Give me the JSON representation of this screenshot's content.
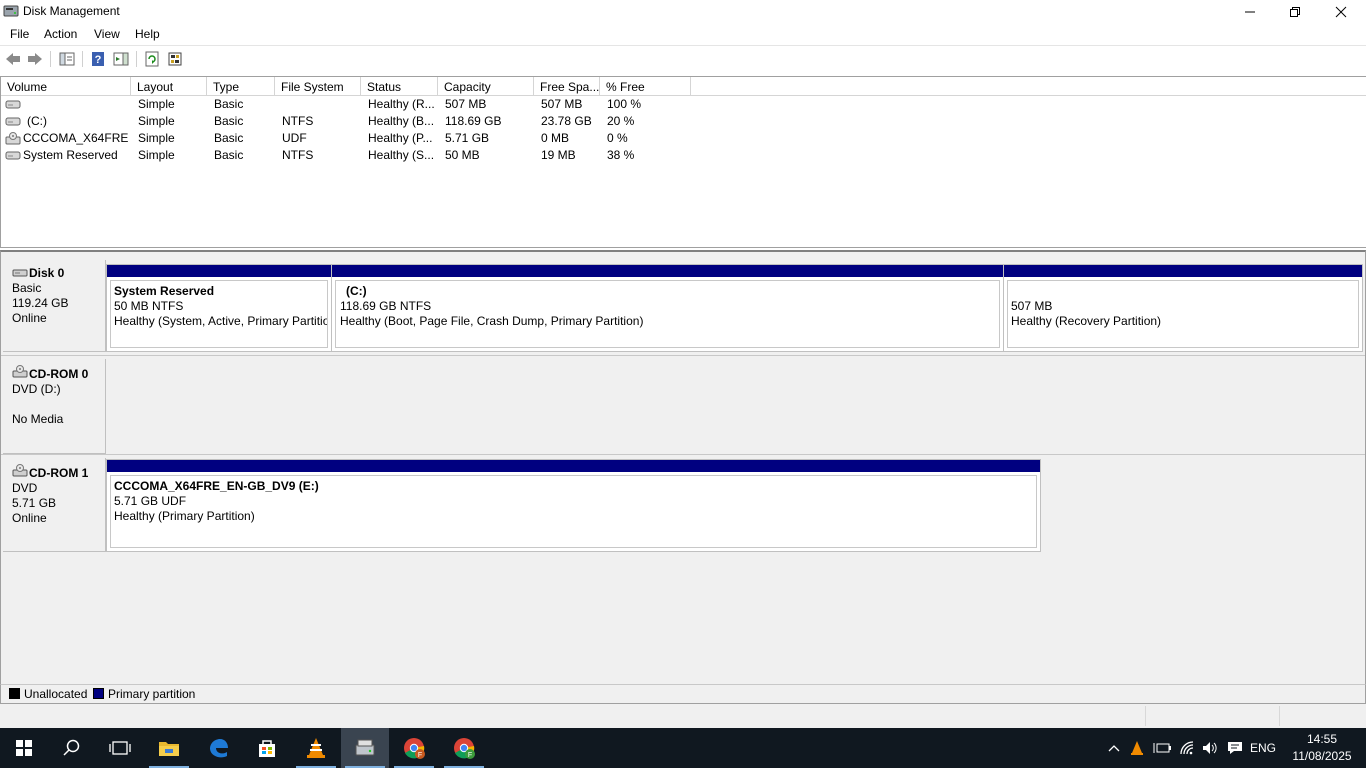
{
  "window": {
    "title": "Disk Management",
    "icon": "disk-management-icon"
  },
  "menu": [
    "File",
    "Action",
    "View",
    "Help"
  ],
  "toolbar": {
    "icons": [
      "back-arrow-icon",
      "forward-arrow-icon",
      "console-tree-icon",
      "help-icon",
      "action-pane-icon",
      "refresh-icon",
      "properties-icon"
    ]
  },
  "volume_table": {
    "columns": [
      "Volume",
      "Layout",
      "Type",
      "File System",
      "Status",
      "Capacity",
      "Free Spa...",
      "% Free"
    ],
    "rows": [
      {
        "volume": "",
        "layout": "Simple",
        "type": "Basic",
        "fs": "",
        "status": "Healthy (R...",
        "capacity": "507 MB",
        "free": "507 MB",
        "pct": "100 %",
        "icon": "drive-icon"
      },
      {
        "volume": "(C:)",
        "layout": "Simple",
        "type": "Basic",
        "fs": "NTFS",
        "status": "Healthy (B...",
        "capacity": "118.69 GB",
        "free": "23.78 GB",
        "pct": "20 %",
        "icon": "drive-icon"
      },
      {
        "volume": "CCCOMA_X64FRE...",
        "layout": "Simple",
        "type": "Basic",
        "fs": "UDF",
        "status": "Healthy (P...",
        "capacity": "5.71 GB",
        "free": "0 MB",
        "pct": "0 %",
        "icon": "cd-drive-icon"
      },
      {
        "volume": "System Reserved",
        "layout": "Simple",
        "type": "Basic",
        "fs": "NTFS",
        "status": "Healthy (S...",
        "capacity": "50 MB",
        "free": "19 MB",
        "pct": "38 %",
        "icon": "drive-icon"
      }
    ]
  },
  "disks": [
    {
      "name": "Disk 0",
      "line1": "Basic",
      "line2": "119.24 GB",
      "line3": "Online",
      "partitions": [
        {
          "name": "System Reserved",
          "size": "50 MB NTFS",
          "status": "Healthy (System, Active, Primary Partition)"
        },
        {
          "name": "(C:)",
          "size": "118.69 GB NTFS",
          "status": "Healthy (Boot, Page File, Crash Dump, Primary Partition)"
        },
        {
          "name": "",
          "size": "507 MB",
          "status": "Healthy (Recovery Partition)"
        }
      ]
    },
    {
      "name": "CD-ROM 0",
      "line1": "DVD (D:)",
      "line2": "",
      "line3": "No Media",
      "partitions": []
    },
    {
      "name": "CD-ROM 1",
      "line1": "DVD",
      "line2": "5.71 GB",
      "line3": "Online",
      "partitions": [
        {
          "name": "CCCOMA_X64FRE_EN-GB_DV9  (E:)",
          "size": "5.71 GB UDF",
          "status": "Healthy (Primary Partition)"
        }
      ]
    }
  ],
  "legend": [
    {
      "label": "Unallocated",
      "color": "#000000"
    },
    {
      "label": "Primary partition",
      "color": "#000080"
    }
  ],
  "taskbar": {
    "apps": [
      "start-icon",
      "search-icon",
      "task-view-icon",
      "file-explorer-icon",
      "edge-icon",
      "store-icon",
      "vlc-icon",
      "disk-management-icon",
      "chrome-icon",
      "chrome-icon"
    ],
    "tray": {
      "language": "ENG",
      "time": "14:55",
      "date": "11/08/2025"
    }
  },
  "colors": {
    "primary_partition": "#000080",
    "taskbar": "#101820"
  }
}
